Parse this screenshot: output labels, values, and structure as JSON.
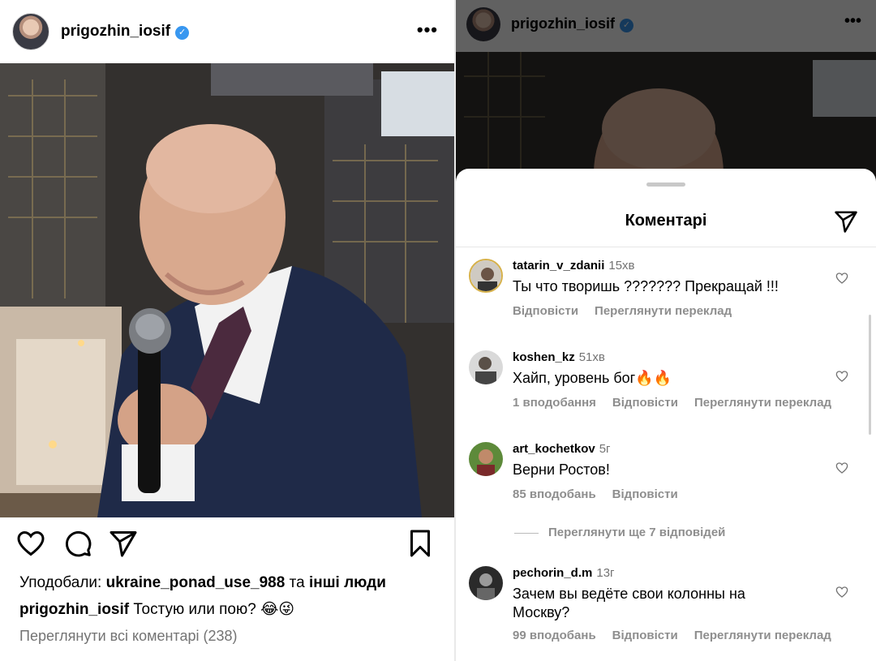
{
  "left_post": {
    "username": "prigozhin_iosif",
    "more_label": "•••",
    "likes_prefix": "Уподобали:",
    "likes_user": "ukraine_ponad_use_988",
    "likes_and": "та",
    "likes_others": "інші люди",
    "caption_user": "prigozhin_iosif",
    "caption_text": "Тостую или пою? 😂😜",
    "view_all_comments": "Переглянути всі коментарі (238)"
  },
  "right_panel": {
    "username": "prigozhin_iosif",
    "more_label": "•••",
    "sheet_title": "Коментарі",
    "comments": [
      {
        "user": "tatarin_v_zdanii",
        "time": "15хв",
        "text": "Ты что творишь ??????? Прекращай !!!",
        "likes": "",
        "reply": "Відповісти",
        "translate": "Переглянути переклад"
      },
      {
        "user": "koshen_kz",
        "time": "51хв",
        "text": "Хайп, уровень бог🔥🔥",
        "likes": "1 вподобання",
        "reply": "Відповісти",
        "translate": "Переглянути переклад"
      },
      {
        "user": "art_kochetkov",
        "time": "5г",
        "text": "Верни Ростов!",
        "likes": "85 вподобань",
        "reply": "Відповісти",
        "translate": ""
      },
      {
        "user": "pechorin_d.m",
        "time": "13г",
        "text": "Зачем вы ведёте свои колонны на Москву?",
        "likes": "99 вподобань",
        "reply": "Відповісти",
        "translate": "Переглянути переклад"
      }
    ],
    "more_replies": "Переглянути ще 7 відповідей"
  },
  "icons": [
    "heart-icon",
    "comment-icon",
    "send-icon",
    "bookmark-icon",
    "verified-icon",
    "more-icon"
  ],
  "colors": {
    "verified": "#3897f0",
    "secondary_text": "#737373"
  }
}
